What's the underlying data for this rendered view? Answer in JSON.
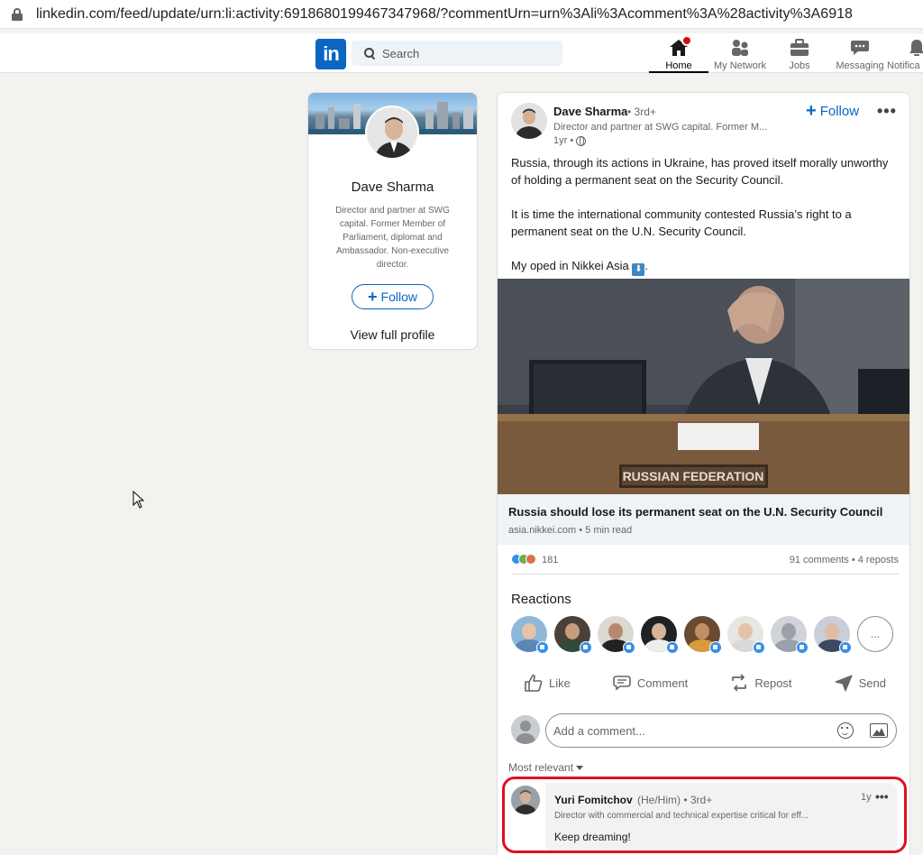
{
  "browser": {
    "url": "linkedin.com/feed/update/urn:li:activity:6918680199467347968/?commentUrn=urn%3Ali%3Acomment%3A%28activity%3A6918"
  },
  "nav": {
    "search_placeholder": "Search",
    "items": [
      {
        "label": "Home",
        "icon": "home-icon"
      },
      {
        "label": "My Network",
        "icon": "network-icon"
      },
      {
        "label": "Jobs",
        "icon": "briefcase-icon"
      },
      {
        "label": "Messaging",
        "icon": "chat-icon"
      },
      {
        "label": "Notifica",
        "icon": "bell-icon"
      }
    ],
    "accent_color": "#0a66c2"
  },
  "profile_card": {
    "name": "Dave Sharma",
    "headline": "Director and partner at SWG capital. Former Member of Parliament, diplomat and Ambassador. Non-executive director.",
    "follow_label": "Follow",
    "view_profile_label": "View full profile"
  },
  "post": {
    "author": "Dave Sharma",
    "degree": "• 3rd+",
    "headline": "Director and partner at SWG capital. Former M...",
    "time": "1yr •",
    "follow_label": "Follow",
    "more_label": "•••",
    "paragraphs": [
      "Russia, through its actions in Ukraine, has proved itself morally unworthy of holding a permanent seat on the Security Council.",
      "It is time the international community contested Russia’s right to a permanent seat on the U.N. Security Council.",
      "My oped in Nikkei Asia"
    ],
    "paragraph_end": ".",
    "article": {
      "image_caption": "RUSSIAN FEDERATION",
      "title": "Russia should lose its permanent seat on the U.N. Security Council",
      "source": "asia.nikkei.com • 5 min read"
    },
    "reaction_count": "181",
    "comments_reposts": "91 comments • 4 reposts",
    "reactions_title": "Reactions",
    "more_reactors_label": "...",
    "actions": [
      {
        "label": "Like",
        "icon": "like-icon"
      },
      {
        "label": "Comment",
        "icon": "comment-icon"
      },
      {
        "label": "Repost",
        "icon": "repost-icon"
      },
      {
        "label": "Send",
        "icon": "send-icon"
      }
    ],
    "comment_placeholder": "Add a comment...",
    "sort_label": "Most relevant"
  },
  "comment": {
    "author": "Yuri Fomitchov",
    "pronouns": "(He/Him) • 3rd+",
    "headline": "Director with commercial and technical expertise critical for eff...",
    "time": "1y",
    "more_label": "•••",
    "text": "Keep dreaming!"
  }
}
